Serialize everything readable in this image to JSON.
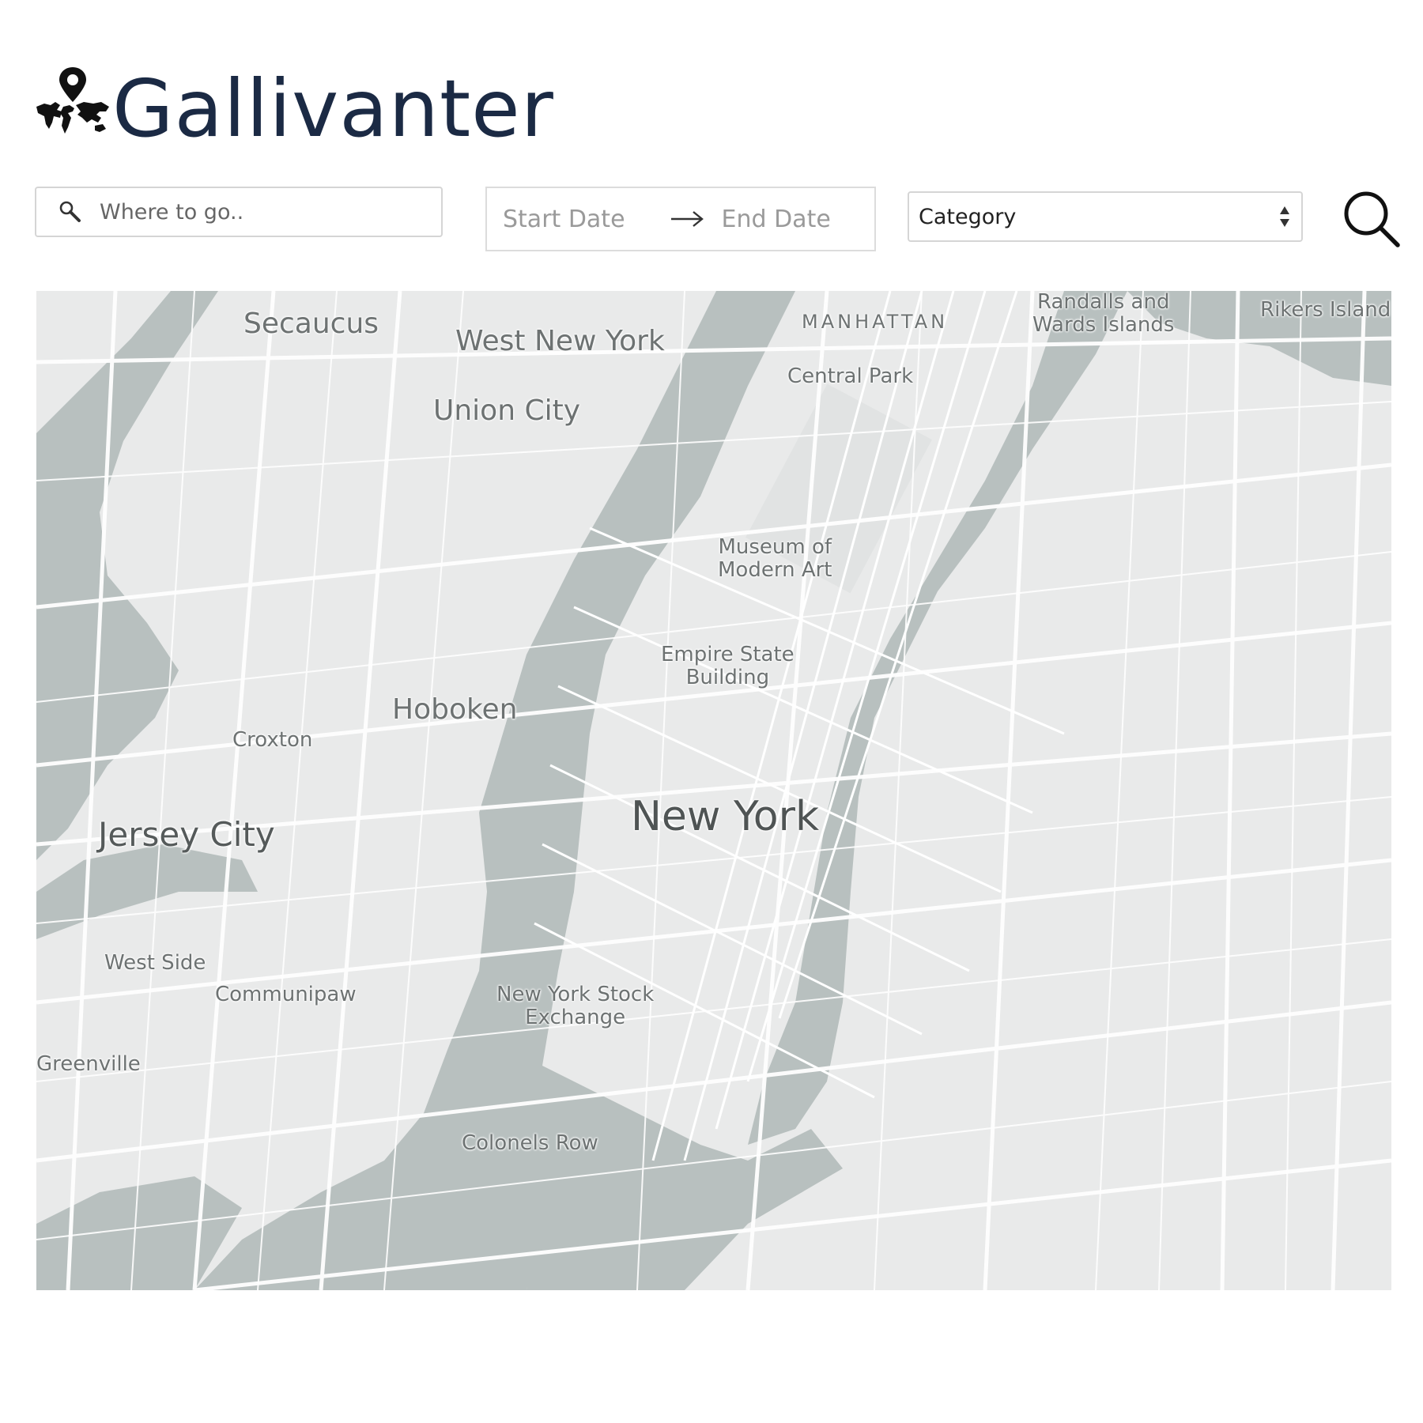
{
  "app": {
    "title": "Gallivanter",
    "logo_icon": "world-map-pin-icon"
  },
  "search": {
    "placeholder": "Where to go..",
    "value": "",
    "icon": "magnifier-icon"
  },
  "dates": {
    "start_placeholder": "Start Date",
    "end_placeholder": "End Date",
    "arrow_icon": "arrow-right-icon"
  },
  "category": {
    "selected": "Category",
    "icon": "updown-icon"
  },
  "search_button": {
    "icon": "search-icon"
  },
  "map": {
    "colors": {
      "land": "#e9eaea",
      "water": "#b8c0bf",
      "road": "#ffffff",
      "label": "#6d7272"
    },
    "labels": {
      "secaucus": "Secaucus",
      "west_new_york": "West New York",
      "union_city": "Union City",
      "manhattan": "MANHATTAN",
      "central_park": "Central Park",
      "randalls": "Randalls and\nWards Islands",
      "rikers": "Rikers Island",
      "moma": "Museum of\nModern Art",
      "empire_state": "Empire State\nBuilding",
      "hoboken": "Hoboken",
      "croxton": "Croxton",
      "jersey_city": "Jersey City",
      "new_york": "New York",
      "west_side": "West Side",
      "communipaw": "Communipaw",
      "nyse": "New York Stock\nExchange",
      "greenville": "Greenville",
      "colonels_row": "Colonels Row"
    }
  }
}
